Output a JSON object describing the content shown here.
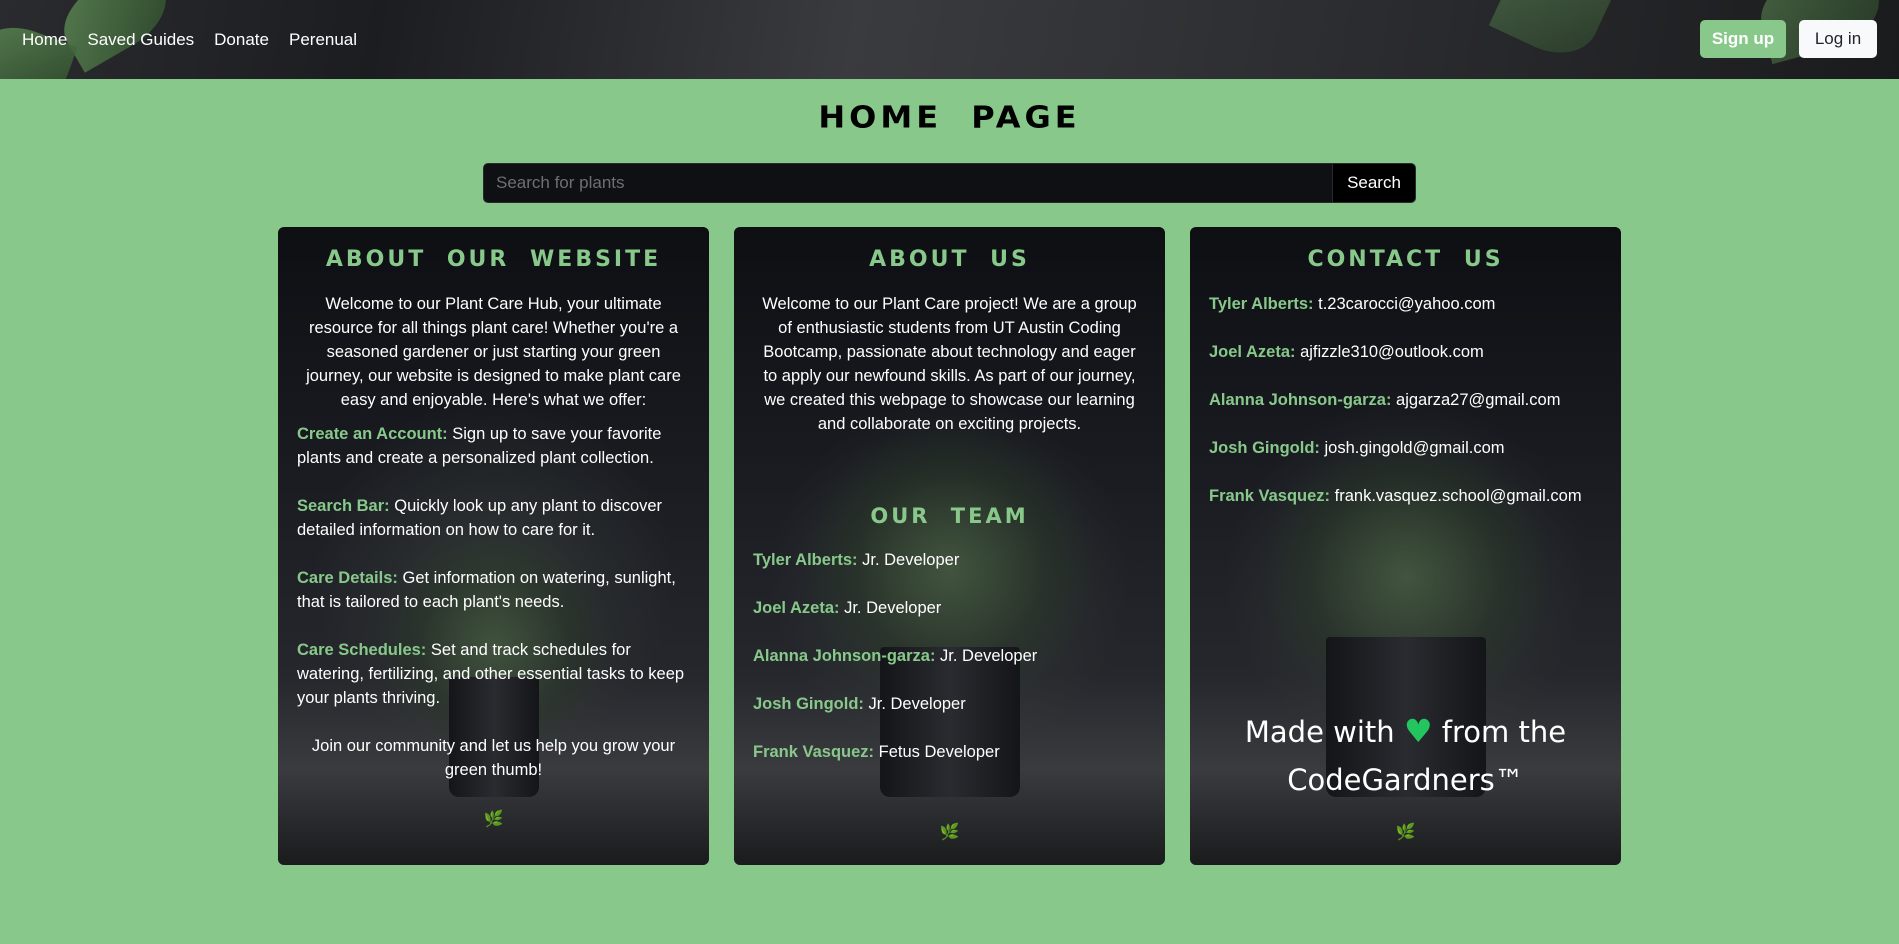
{
  "nav": {
    "links": [
      "Home",
      "Saved Guides",
      "Donate",
      "Perenual"
    ],
    "signup": "Sign up",
    "login": "Log in"
  },
  "page": {
    "title": "HOME PAGE"
  },
  "search": {
    "placeholder": "Search for plants",
    "button": "Search"
  },
  "about_website": {
    "title": "ABOUT OUR WEBSITE",
    "intro": "Welcome to our Plant Care Hub, your ultimate resource for all things plant care! Whether you're a seasoned gardener or just starting your green journey, our website is designed to make plant care easy and enjoyable. Here's what we offer:",
    "features": [
      {
        "label": "Create an Account:",
        "text": "Sign up to save your favorite plants and create a personalized plant collection."
      },
      {
        "label": "Search Bar:",
        "text": "Quickly look up any plant to discover detailed information on how to care for it."
      },
      {
        "label": "Care Details:",
        "text": "Get information on watering, sunlight, that is tailored to each plant's needs."
      },
      {
        "label": "Care Schedules:",
        "text": "Set and track schedules for watering, fertilizing, and other essential tasks to keep your plants thriving."
      }
    ],
    "closing": "Join our community and let us help you grow your green thumb!"
  },
  "about_us": {
    "title": "ABOUT US",
    "intro": "Welcome to our Plant Care project! We are a group of enthusiastic students from UT Austin Coding Bootcamp, passionate about technology and eager to apply our newfound skills. As part of our journey, we created this webpage to showcase our learning and collaborate on exciting projects.",
    "team_title": "OUR TEAM",
    "team": [
      {
        "name": "Tyler Alberts:",
        "role": "Jr. Developer"
      },
      {
        "name": "Joel Azeta:",
        "role": "Jr. Developer"
      },
      {
        "name": "Alanna Johnson-garza:",
        "role": "Jr. Developer"
      },
      {
        "name": "Josh Gingold:",
        "role": "Jr. Developer"
      },
      {
        "name": "Frank Vasquez:",
        "role": "Fetus Developer"
      }
    ]
  },
  "contact": {
    "title": "CONTACT US",
    "people": [
      {
        "name": "Tyler Alberts:",
        "email": "t.23carocci@yahoo.com"
      },
      {
        "name": "Joel Azeta:",
        "email": "ajfizzle310@outlook.com"
      },
      {
        "name": "Alanna Johnson-garza:",
        "email": "ajgarza27@gmail.com"
      },
      {
        "name": "Josh Gingold:",
        "email": "josh.gingold@gmail.com"
      },
      {
        "name": "Frank Vasquez:",
        "email": "frank.vasquez.school@gmail.com"
      }
    ],
    "made_with_pre": "Made with",
    "made_with_post": "from the",
    "brand": "CodeGardners™"
  },
  "colors": {
    "accent": "#88c98b",
    "heart": "#22c55e",
    "leaf": "#7bd34a"
  },
  "icons": {
    "heart": "heart-icon",
    "leaf": "leaf-icon"
  }
}
